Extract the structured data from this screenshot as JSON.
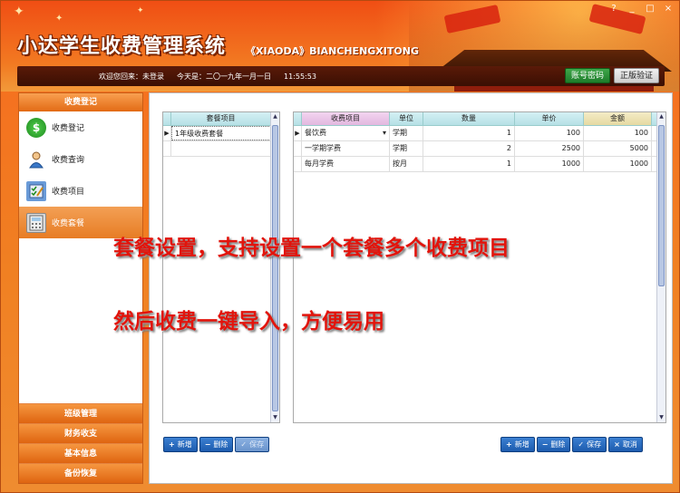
{
  "app": {
    "title": "小达学生收费管理系统",
    "subtitle": "《XIAODA》BIANCHENGXITONG",
    "window_controls": [
      "?",
      "_",
      "□",
      "×"
    ]
  },
  "status": {
    "welcome": "欢迎您回来：未登录",
    "today": "今天是：二〇一九年一月一日",
    "time": "11:55:53",
    "account_button": "账号密码",
    "verify_button": "正版验证"
  },
  "sidebar": {
    "header": "收费登记",
    "items": [
      {
        "label": "收费登记",
        "icon": "coin-icon"
      },
      {
        "label": "收费查询",
        "icon": "user-icon"
      },
      {
        "label": "收费项目",
        "icon": "checklist-icon"
      },
      {
        "label": "收费套餐",
        "icon": "calculator-icon"
      }
    ],
    "sections": [
      "班级管理",
      "财务收支",
      "基本信息",
      "备份恢复"
    ]
  },
  "package_grid": {
    "header": "套餐项目",
    "rows": [
      "1年级收费套餐"
    ]
  },
  "item_grid": {
    "columns": [
      "收费项目",
      "单位",
      "数量",
      "单价",
      "金额"
    ],
    "rows": [
      {
        "item": "餐饮费",
        "unit": "学期",
        "qty": "1",
        "price": "100",
        "amount": "100"
      },
      {
        "item": "一学期学费",
        "unit": "学期",
        "qty": "2",
        "price": "2500",
        "amount": "5000"
      },
      {
        "item": "每月学费",
        "unit": "按月",
        "qty": "1",
        "price": "1000",
        "amount": "1000"
      }
    ]
  },
  "left_buttons": {
    "add": "新增",
    "delete": "删除",
    "save": "保存"
  },
  "right_buttons": {
    "add": "新增",
    "delete": "删除",
    "save": "保存",
    "cancel": "取消"
  },
  "overlay": {
    "line1": "套餐设置，支持设置一个套餐多个收费项目",
    "line2": "然后收费一键导入，方便易用"
  },
  "colors": {
    "header_orange": "#f04e14",
    "overlay_red": "#e2140c",
    "button_blue": "#1d5cae"
  }
}
